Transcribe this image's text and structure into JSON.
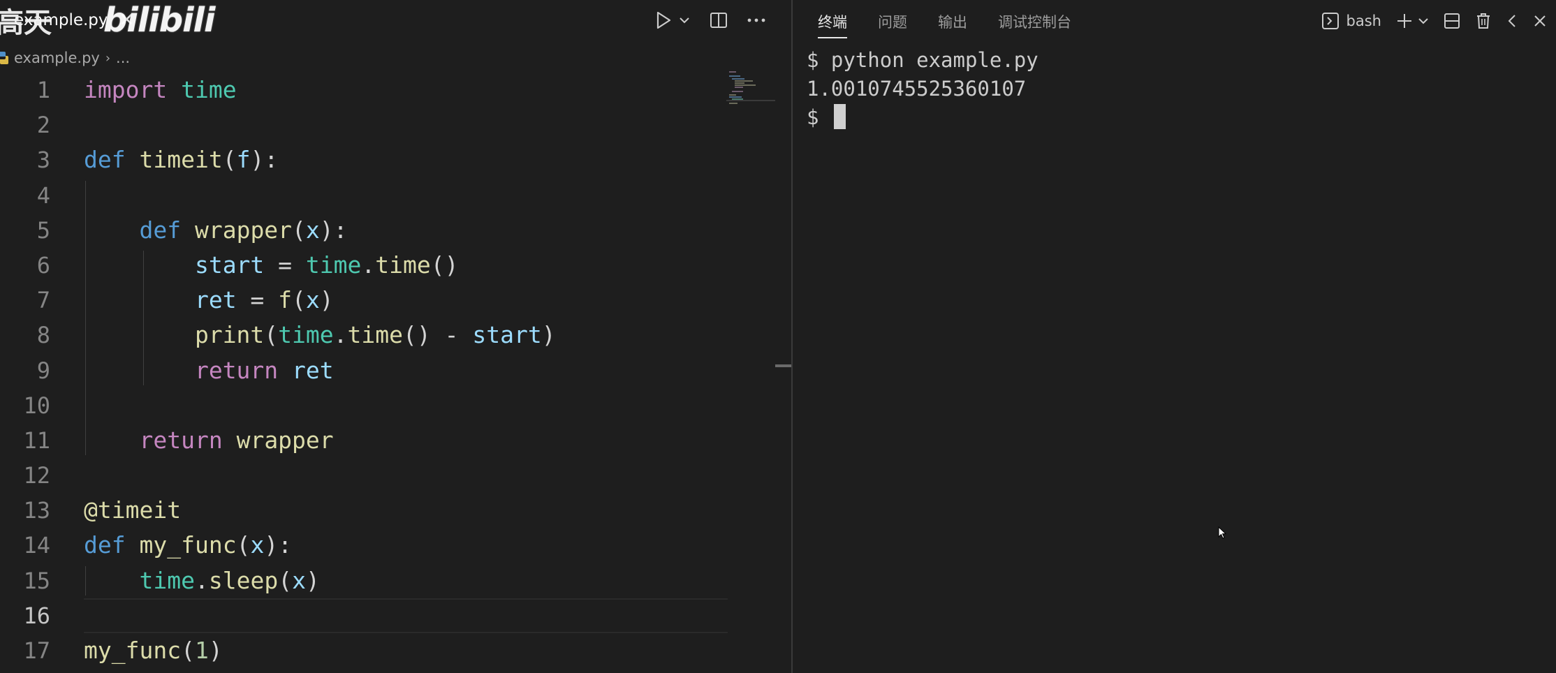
{
  "editor": {
    "tab": {
      "filename": "example.py",
      "close_glyph": "✕"
    },
    "watermark": {
      "text_cn": "高天",
      "logo": "bilibili"
    },
    "breadcrumb": {
      "file": "example.py",
      "separator": "›",
      "more": "..."
    },
    "actions": {
      "run": "play-icon",
      "run_dropdown": "chevron-down-icon",
      "split": "split-editor-icon",
      "more": "ellipsis-icon"
    },
    "current_line": 16,
    "lines": [
      {
        "n": "1",
        "tokens": [
          [
            "kw",
            "import"
          ],
          [
            "op",
            " "
          ],
          [
            "mod",
            "time"
          ]
        ]
      },
      {
        "n": "2",
        "tokens": []
      },
      {
        "n": "3",
        "tokens": [
          [
            "kd",
            "def"
          ],
          [
            "op",
            " "
          ],
          [
            "fn",
            "timeit"
          ],
          [
            "op",
            "("
          ],
          [
            "var",
            "f"
          ],
          [
            "op",
            "):"
          ]
        ]
      },
      {
        "n": "4",
        "tokens": []
      },
      {
        "n": "5",
        "tokens": [
          [
            "op",
            "    "
          ],
          [
            "kd",
            "def"
          ],
          [
            "op",
            " "
          ],
          [
            "fn",
            "wrapper"
          ],
          [
            "op",
            "("
          ],
          [
            "var",
            "x"
          ],
          [
            "op",
            "):"
          ]
        ]
      },
      {
        "n": "6",
        "tokens": [
          [
            "op",
            "        "
          ],
          [
            "var",
            "start"
          ],
          [
            "op",
            " = "
          ],
          [
            "mod",
            "time"
          ],
          [
            "op",
            "."
          ],
          [
            "fn",
            "time"
          ],
          [
            "op",
            "()"
          ]
        ]
      },
      {
        "n": "7",
        "tokens": [
          [
            "op",
            "        "
          ],
          [
            "var",
            "ret"
          ],
          [
            "op",
            " = "
          ],
          [
            "fn",
            "f"
          ],
          [
            "op",
            "("
          ],
          [
            "var",
            "x"
          ],
          [
            "op",
            ")"
          ]
        ]
      },
      {
        "n": "8",
        "tokens": [
          [
            "op",
            "        "
          ],
          [
            "fn",
            "print"
          ],
          [
            "op",
            "("
          ],
          [
            "mod",
            "time"
          ],
          [
            "op",
            "."
          ],
          [
            "fn",
            "time"
          ],
          [
            "op",
            "() - "
          ],
          [
            "var",
            "start"
          ],
          [
            "op",
            ")"
          ]
        ]
      },
      {
        "n": "9",
        "tokens": [
          [
            "op",
            "        "
          ],
          [
            "kw",
            "return"
          ],
          [
            "op",
            " "
          ],
          [
            "var",
            "ret"
          ]
        ]
      },
      {
        "n": "10",
        "tokens": []
      },
      {
        "n": "11",
        "tokens": [
          [
            "op",
            "    "
          ],
          [
            "kw",
            "return"
          ],
          [
            "op",
            " "
          ],
          [
            "fn",
            "wrapper"
          ]
        ]
      },
      {
        "n": "12",
        "tokens": []
      },
      {
        "n": "13",
        "tokens": [
          [
            "fn",
            "@timeit"
          ]
        ]
      },
      {
        "n": "14",
        "tokens": [
          [
            "kd",
            "def"
          ],
          [
            "op",
            " "
          ],
          [
            "fn",
            "my_func"
          ],
          [
            "op",
            "("
          ],
          [
            "var",
            "x"
          ],
          [
            "op",
            "):"
          ]
        ]
      },
      {
        "n": "15",
        "tokens": [
          [
            "op",
            "    "
          ],
          [
            "mod",
            "time"
          ],
          [
            "op",
            "."
          ],
          [
            "fn",
            "sleep"
          ],
          [
            "op",
            "("
          ],
          [
            "var",
            "x"
          ],
          [
            "op",
            ")"
          ]
        ]
      },
      {
        "n": "16",
        "tokens": []
      },
      {
        "n": "17",
        "tokens": [
          [
            "fn",
            "my_func"
          ],
          [
            "op",
            "("
          ],
          [
            "num",
            "1"
          ],
          [
            "op",
            ")"
          ]
        ]
      }
    ]
  },
  "panel": {
    "tabs": [
      {
        "label": "终端",
        "active": true
      },
      {
        "label": "问题",
        "active": false
      },
      {
        "label": "输出",
        "active": false
      },
      {
        "label": "调试控制台",
        "active": false
      }
    ],
    "terminal_selector": {
      "label": "bash"
    },
    "terminal": {
      "lines": [
        "$ python example.py",
        "1.0010745525360107",
        "$ "
      ]
    }
  },
  "colors": {
    "background": "#1e1e1e",
    "keyword_control": "#c586c0",
    "keyword_decl": "#569cd6",
    "function": "#dcdcaa",
    "variable": "#9cdcfe",
    "module": "#4ec9b0",
    "number": "#b5cea8"
  }
}
